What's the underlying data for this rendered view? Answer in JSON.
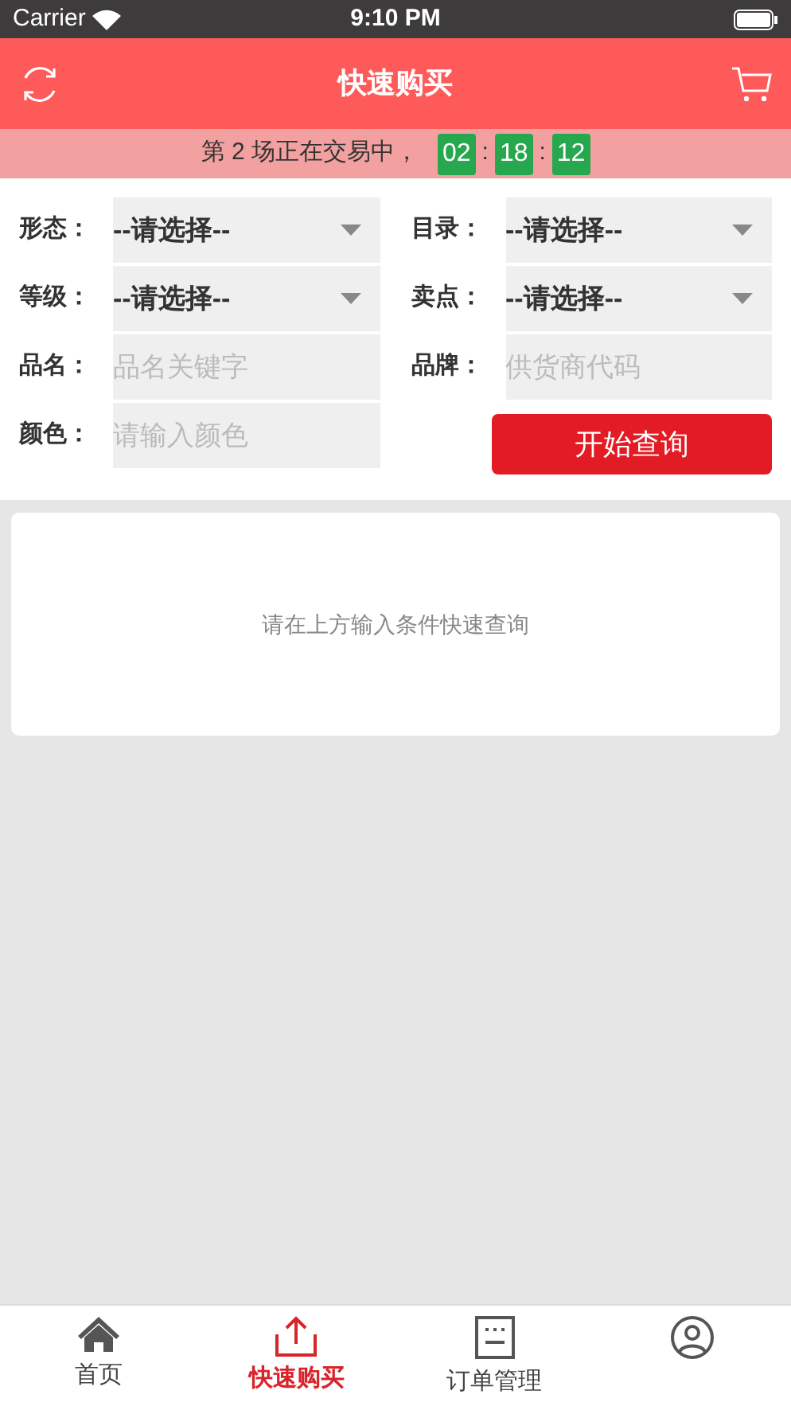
{
  "status_bar": {
    "carrier": "Carrier",
    "time": "9:10 PM"
  },
  "header": {
    "title": "快速购买"
  },
  "banner": {
    "text": "第 2 场正在交易中，",
    "countdown": [
      "02",
      "18",
      "12"
    ],
    "separator": ":"
  },
  "form": {
    "fields": [
      {
        "label": "形态：",
        "kind": "select",
        "value": "--请选择--"
      },
      {
        "label": "目录：",
        "kind": "select",
        "value": "--请选择--"
      },
      {
        "label": "等级：",
        "kind": "select",
        "value": "--请选择--"
      },
      {
        "label": "卖点：",
        "kind": "select",
        "value": "--请选择--"
      },
      {
        "label": "品名：",
        "kind": "input",
        "placeholder": "品名关键字"
      },
      {
        "label": "品牌：",
        "kind": "input",
        "placeholder": "供货商代码"
      },
      {
        "label": "颜色：",
        "kind": "input",
        "placeholder": "请输入颜色"
      }
    ],
    "submit": "开始查询"
  },
  "result": {
    "message": "请在上方输入条件快速查询"
  },
  "tab_bar": [
    {
      "label": "首页",
      "selected": false
    },
    {
      "label": "快速购买",
      "selected": true
    },
    {
      "label": "订单管理",
      "selected": false
    },
    {
      "selected": false
    }
  ]
}
